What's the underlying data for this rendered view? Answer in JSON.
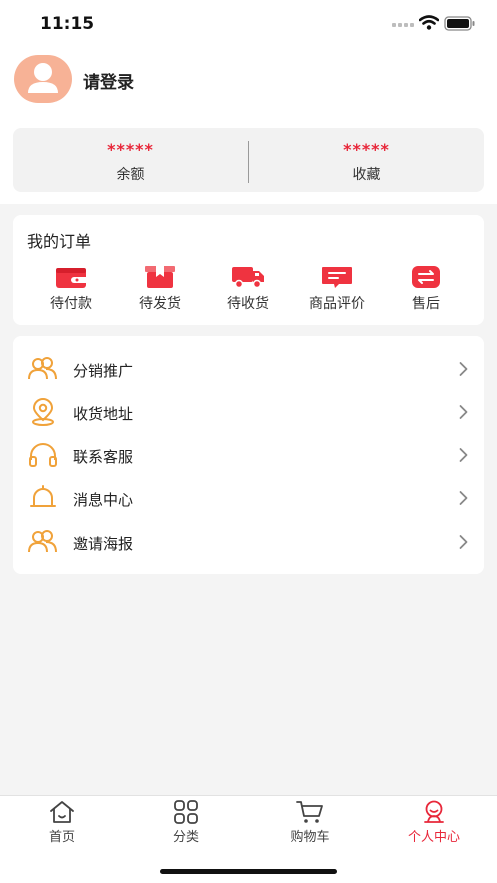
{
  "status_bar": {
    "time": "11:15"
  },
  "profile": {
    "login_text": "请登录",
    "icon": "user-avatar-icon"
  },
  "stats": [
    {
      "value": "*****",
      "label": "余额"
    },
    {
      "value": "*****",
      "label": "收藏"
    }
  ],
  "orders": {
    "title": "我的订单",
    "items": [
      {
        "label": "待付款",
        "icon": "wallet-icon"
      },
      {
        "label": "待发货",
        "icon": "package-icon"
      },
      {
        "label": "待收货",
        "icon": "truck-icon"
      },
      {
        "label": "商品评价",
        "icon": "comment-icon"
      },
      {
        "label": "售后",
        "icon": "exchange-icon"
      }
    ]
  },
  "menu": [
    {
      "label": "分销推广",
      "icon": "users-icon"
    },
    {
      "label": "收货地址",
      "icon": "location-icon"
    },
    {
      "label": "联系客服",
      "icon": "headset-icon"
    },
    {
      "label": "消息中心",
      "icon": "bell-icon"
    },
    {
      "label": "邀请海报",
      "icon": "users-icon"
    }
  ],
  "tabbar": [
    {
      "label": "首页",
      "icon": "home-icon",
      "active": false
    },
    {
      "label": "分类",
      "icon": "grid-icon",
      "active": false
    },
    {
      "label": "购物车",
      "icon": "cart-icon",
      "active": false
    },
    {
      "label": "个人中心",
      "icon": "profile-icon",
      "active": true
    }
  ],
  "colors": {
    "accent": "#e8273a",
    "menu_icon": "#f0a23a",
    "avatar_bg": "#f7b296"
  }
}
